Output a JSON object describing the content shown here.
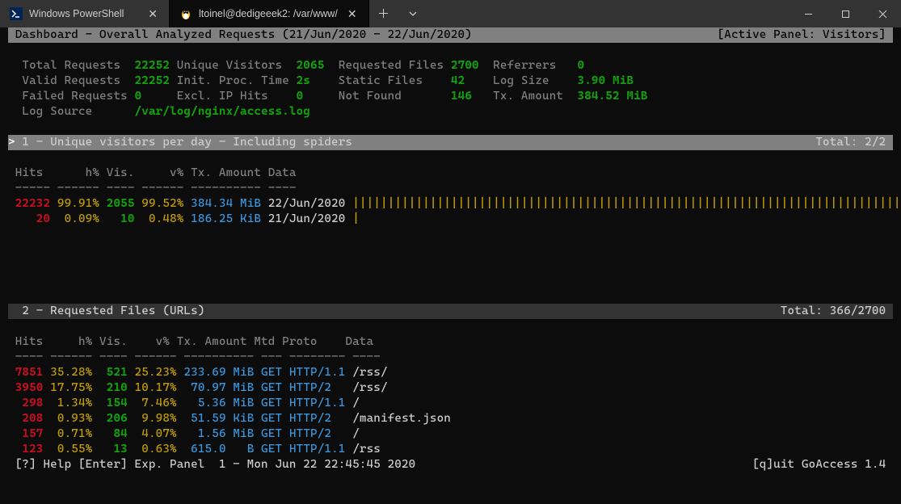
{
  "tabs": [
    {
      "title": "Windows PowerShell",
      "active": false
    },
    {
      "title": "ltoinel@dedigeeek2: /var/www/",
      "active": true
    }
  ],
  "header": {
    "title_left": " Dashboard - Overall Analyzed Requests (21/Jun/2020 - 22/Jun/2020)",
    "title_right": "[Active Panel: Visitors] "
  },
  "summary": {
    "labels": {
      "total_requests": "Total Requests",
      "unique_visitors": "Unique Visitors",
      "requested_files": "Requested Files",
      "referrers": "Referrers",
      "valid_requests": "Valid Requests",
      "init_proc_time": "Init. Proc. Time",
      "static_files": "Static Files",
      "log_size": "Log Size",
      "failed_requests": "Failed Requests",
      "excl_ip_hits": "Excl. IP Hits",
      "not_found": "Not Found",
      "tx_amount": "Tx. Amount",
      "log_source": "Log Source"
    },
    "values": {
      "total_requests": "22252",
      "unique_visitors": "2065",
      "requested_files": "2700",
      "referrers": "0",
      "valid_requests": "22252",
      "init_proc_time": "2s",
      "static_files": "42",
      "log_size": "3.90 MiB",
      "failed_requests": "0",
      "excl_ip_hits": "0",
      "not_found": "146",
      "tx_amount": "384.52 MiB",
      "log_source": "/var/log/nginx/access.log"
    }
  },
  "panels": {
    "p1": {
      "caret": "> ",
      "title": "1 - Unique visitors per day - Including spiders",
      "total": "Total: 2/2 ",
      "cols": " Hits      h% Vis.     v% Tx. Amount Data",
      "sep": " ----- ------ ---- ------ ---------- ----",
      "rows": [
        {
          "hits": "22232",
          "hp": "99.91%",
          "vis": "2055",
          "vp": "99.52%",
          "tx": "384.34 MiB",
          "data": "22/Jun/2020",
          "bar": "|||||||||||||||||||||||||||||||||||||||||||||||||||||||||||||||||||||||||||||||"
        },
        {
          "hits": "   20",
          "hp": " 0.09%",
          "vis": "  10",
          "vp": " 0.48%",
          "tx": "186.25 KiB",
          "data": "21/Jun/2020",
          "bar": "|"
        }
      ]
    },
    "p2": {
      "title": "  2 - Requested Files (URLs)",
      "total": "Total: 366/2700 ",
      "cols": " Hits     h% Vis.    v% Tx. Amount Mtd Proto    Data",
      "sep": " ---- ------ ---- ------ ---------- --- -------- ----",
      "rows": [
        {
          "hits": " 7851",
          "hp": "35.28%",
          "vis": " 521",
          "vp": "25.23%",
          "tx": "233.69 MiB",
          "mtd": "GET",
          "proto": "HTTP/1.1",
          "data": "/rss/"
        },
        {
          "hits": " 3950",
          "hp": "17.75%",
          "vis": " 210",
          "vp": "10.17%",
          "tx": " 70.97 MiB",
          "mtd": "GET",
          "proto": "HTTP/2",
          "data": "/rss/"
        },
        {
          "hits": "  298",
          "hp": " 1.34%",
          "vis": " 154",
          "vp": " 7.46%",
          "tx": "  5.36 MiB",
          "mtd": "GET",
          "proto": "HTTP/1.1",
          "data": "/"
        },
        {
          "hits": "  208",
          "hp": " 0.93%",
          "vis": " 206",
          "vp": " 9.98%",
          "tx": " 51.59 KiB",
          "mtd": "GET",
          "proto": "HTTP/2",
          "data": "/manifest.json"
        },
        {
          "hits": "  157",
          "hp": " 0.71%",
          "vis": "  84",
          "vp": " 4.07%",
          "tx": "  1.56 MiB",
          "mtd": "GET",
          "proto": "HTTP/2",
          "data": "/"
        },
        {
          "hits": "  123",
          "hp": " 0.55%",
          "vis": "  13",
          "vp": " 0.63%",
          "tx": " 615.0   B",
          "mtd": "GET",
          "proto": "HTTP/1.1",
          "data": "/rss"
        }
      ]
    }
  },
  "footer": {
    "left": " [?] Help [Enter] Exp. Panel  1 - Mon Jun 22 22:45:45 2020",
    "right": "[q]uit GoAccess 1.4 "
  }
}
